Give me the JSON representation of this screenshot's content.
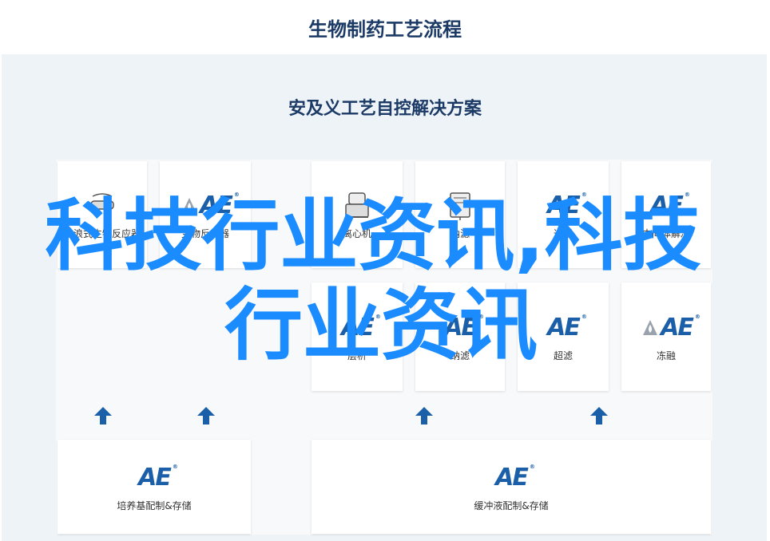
{
  "page_title": "生物制药工艺流程",
  "panel_title": "安及义工艺自控解决方案",
  "brand_mark": "AE",
  "brand_sup": "®",
  "top_row": [
    {
      "label": "波浪式生物反应器",
      "icon": "wave-bioreactor-icon"
    },
    {
      "label": "生物反应器",
      "icon": "ae-logo-icon"
    },
    {
      "label": "离心机",
      "icon": "centrifuge-icon"
    },
    {
      "label": "纳滤",
      "icon": "filter-machine-icon"
    },
    {
      "label": "过滤",
      "icon": "ae-logo-icon"
    },
    {
      "label": "中间体解决",
      "icon": "ae-logo-icon"
    }
  ],
  "mid_row": [
    {
      "label": "层析",
      "icon": "ae-logo-icon"
    },
    {
      "label": "纳滤",
      "icon": "ae-logo-icon"
    },
    {
      "label": "超滤",
      "icon": "ae-logo-icon"
    },
    {
      "label": "冻融",
      "icon": "ae-logo-icon"
    }
  ],
  "bottom_row": [
    {
      "label": "培养基配制&存储",
      "icon": "ae-logo-icon"
    },
    {
      "label": "缓冲液配制&存储",
      "icon": "ae-logo-icon"
    }
  ],
  "colors": {
    "accent": "#1a5fa8",
    "title": "#1b3a66",
    "watermark": "#1a8cff"
  },
  "watermark": {
    "line1": "科技行业资讯,科技",
    "line2": "行业资讯"
  }
}
